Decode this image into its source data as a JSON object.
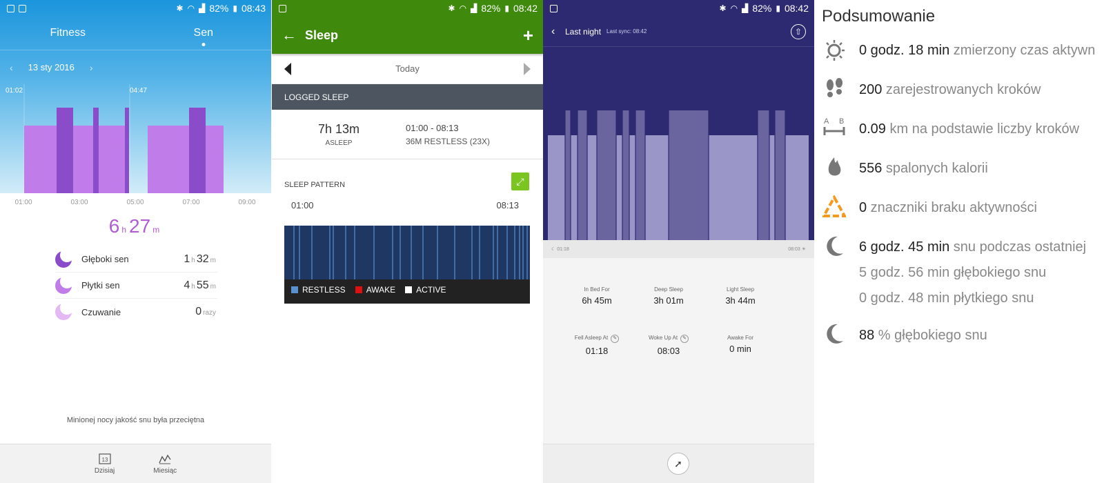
{
  "p1": {
    "status": {
      "battery": "82%",
      "time": "08:43"
    },
    "tabs": [
      "Fitness",
      "Sen"
    ],
    "date": "13 sty 2016",
    "chart_labels": {
      "start": "01:02",
      "end": "04:47"
    },
    "axis": [
      "01:00",
      "03:00",
      "05:00",
      "07:00",
      "09:00"
    ],
    "total": {
      "h": "6",
      "h_unit": "h",
      "m": "27",
      "m_unit": "m"
    },
    "rows": [
      {
        "label": "Głęboki sen",
        "h": "1",
        "h_unit": "h",
        "m": "32",
        "m_unit": "m"
      },
      {
        "label": "Płytki sen",
        "h": "4",
        "h_unit": "h",
        "m": "55",
        "m_unit": "m"
      },
      {
        "label": "Czuwanie",
        "val": "0",
        "unit": "razy"
      }
    ],
    "quality": "Minionej nocy jakość snu była przeciętna",
    "bottom_tabs": [
      {
        "label": "Dzisiaj",
        "icon_text": "13"
      },
      {
        "label": "Miesiąc"
      }
    ]
  },
  "p2": {
    "status": {
      "battery": "82%",
      "time": "08:42"
    },
    "title": "Sleep",
    "day": "Today",
    "section": "LOGGED SLEEP",
    "asleep": {
      "duration": "7h 13m",
      "label": "ASLEEP"
    },
    "range": {
      "times": "01:00 - 08:13",
      "restless": "36M RESTLESS (23X)"
    },
    "pattern_title": "SLEEP PATTERN",
    "pattern_start": "01:00",
    "pattern_end": "08:13",
    "legend": [
      {
        "label": "RESTLESS",
        "color": "#5a8fd0"
      },
      {
        "label": "AWAKE",
        "color": "#e01010"
      },
      {
        "label": "ACTIVE",
        "color": "#ffffff"
      }
    ]
  },
  "p3": {
    "status": {
      "battery": "82%",
      "time": "08:42"
    },
    "header": {
      "title": "Last night",
      "sync": "Last sync: 08:42"
    },
    "strip": {
      "start": "01:18",
      "end": "08:03"
    },
    "stats": [
      {
        "k": "In Bed For",
        "v": "6h 45m"
      },
      {
        "k": "Deep Sleep",
        "v": "3h 01m"
      },
      {
        "k": "Light Sleep",
        "v": "3h 44m"
      },
      {
        "k": "Fell Asleep At",
        "v": "01:18"
      },
      {
        "k": "Woke Up At",
        "v": "08:03"
      },
      {
        "k": "Awake For",
        "v": "0 min"
      }
    ]
  },
  "p4": {
    "title": "Podsumowanie",
    "lines": [
      {
        "n": "0 godz. 18 min",
        "d": " zmierzony czas aktywn"
      },
      {
        "n": "200",
        "d": " zarejestrowanych kroków"
      },
      {
        "n": "0.09",
        "d": " km na podstawie liczby kroków"
      },
      {
        "n": "556",
        "d": " spalonych kalorii"
      },
      {
        "n": "0",
        "d": " znaczniki braku aktywności"
      },
      {
        "n": "6 godz. 45 min",
        "d": " snu podczas ostatniej"
      },
      {
        "n": "",
        "d": "5 godz. 56 min głębokiego snu"
      },
      {
        "n": "",
        "d": "0 godz. 48 min płytkiego snu"
      },
      {
        "n": "88",
        "d": " % głębokiego snu"
      }
    ],
    "ab_icon": {
      "a": "A",
      "b": "B"
    }
  }
}
